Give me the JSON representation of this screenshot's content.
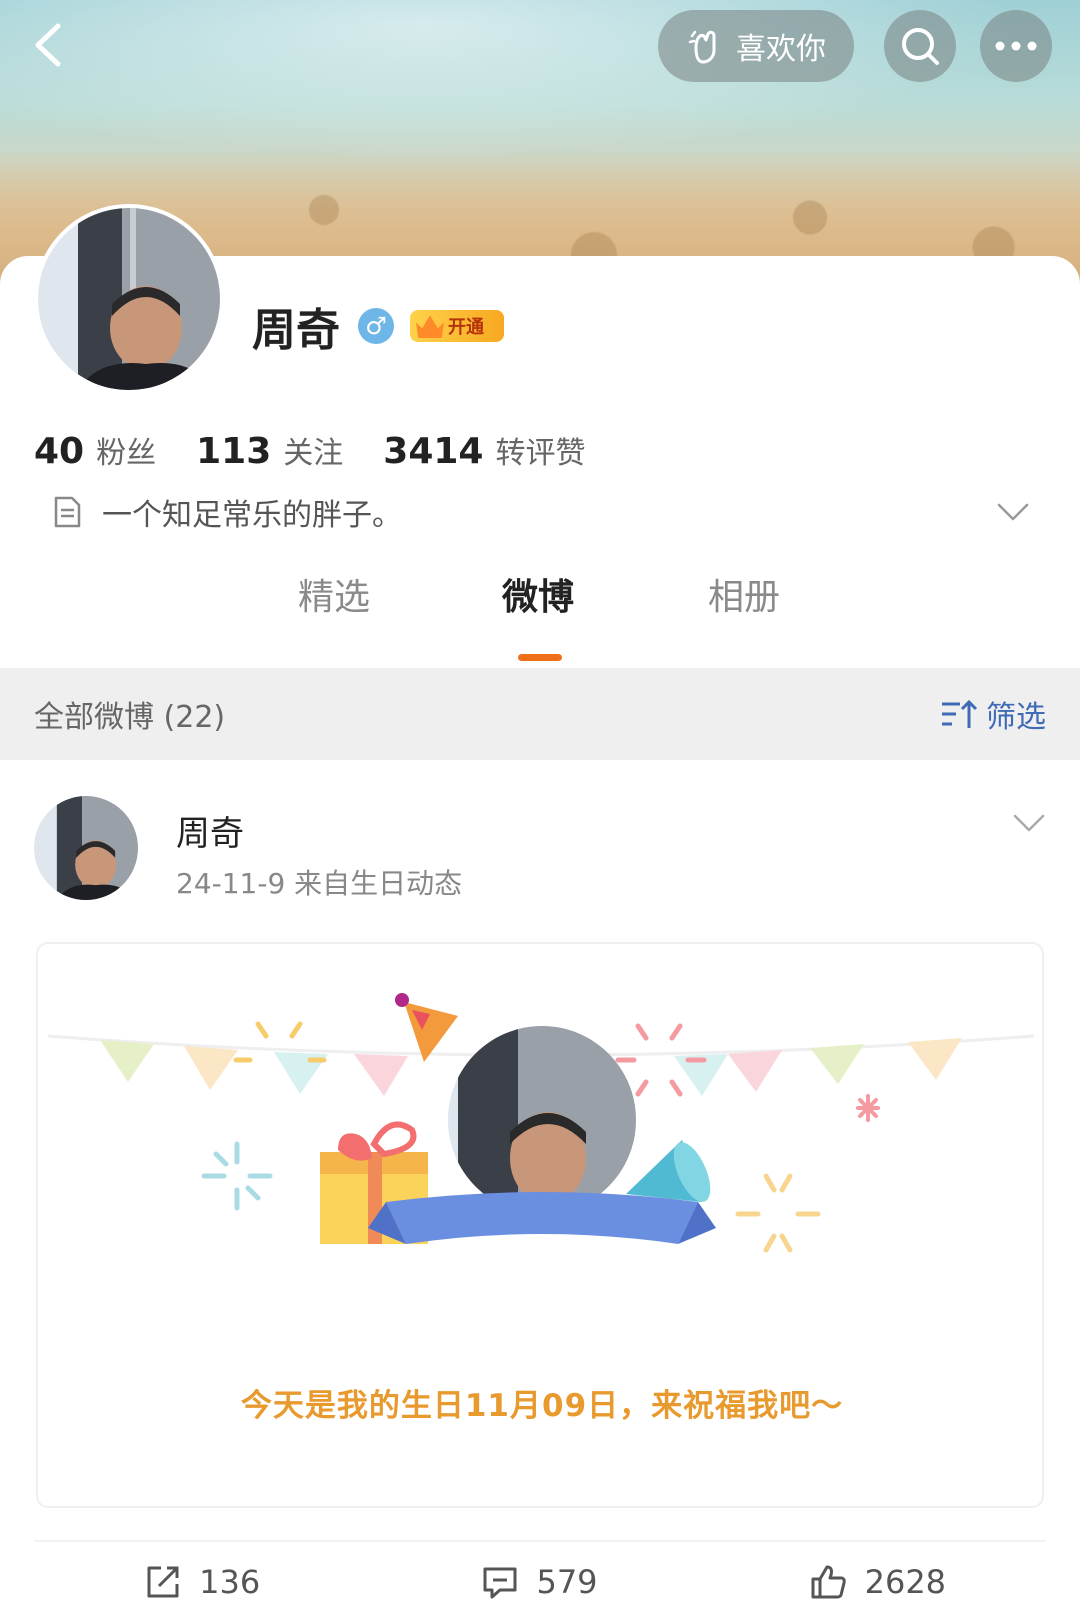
{
  "header": {
    "like_label": "喜欢你"
  },
  "profile": {
    "name": "周奇",
    "vip_label": "开通",
    "stats": [
      {
        "num": "40",
        "label": "粉丝"
      },
      {
        "num": "113",
        "label": "关注"
      },
      {
        "num": "3414",
        "label": "转评赞"
      }
    ],
    "bio": "一个知足常乐的胖子。"
  },
  "tabs": [
    "精选",
    "微博",
    "相册"
  ],
  "active_tab": "微博",
  "filter": {
    "title": "全部微博 (22)",
    "button": "筛选"
  },
  "post": {
    "author": "周奇",
    "meta": "24-11-9  来自生日动态",
    "birthday_text": "今天是我的生日11月09日，来祝福我吧～",
    "actions": {
      "repost": "136",
      "comment": "579",
      "like": "2628"
    }
  },
  "colors": {
    "accent": "#f0701a",
    "filter_blue": "#3f6bb6",
    "birthday_text": "#e89a2f"
  }
}
